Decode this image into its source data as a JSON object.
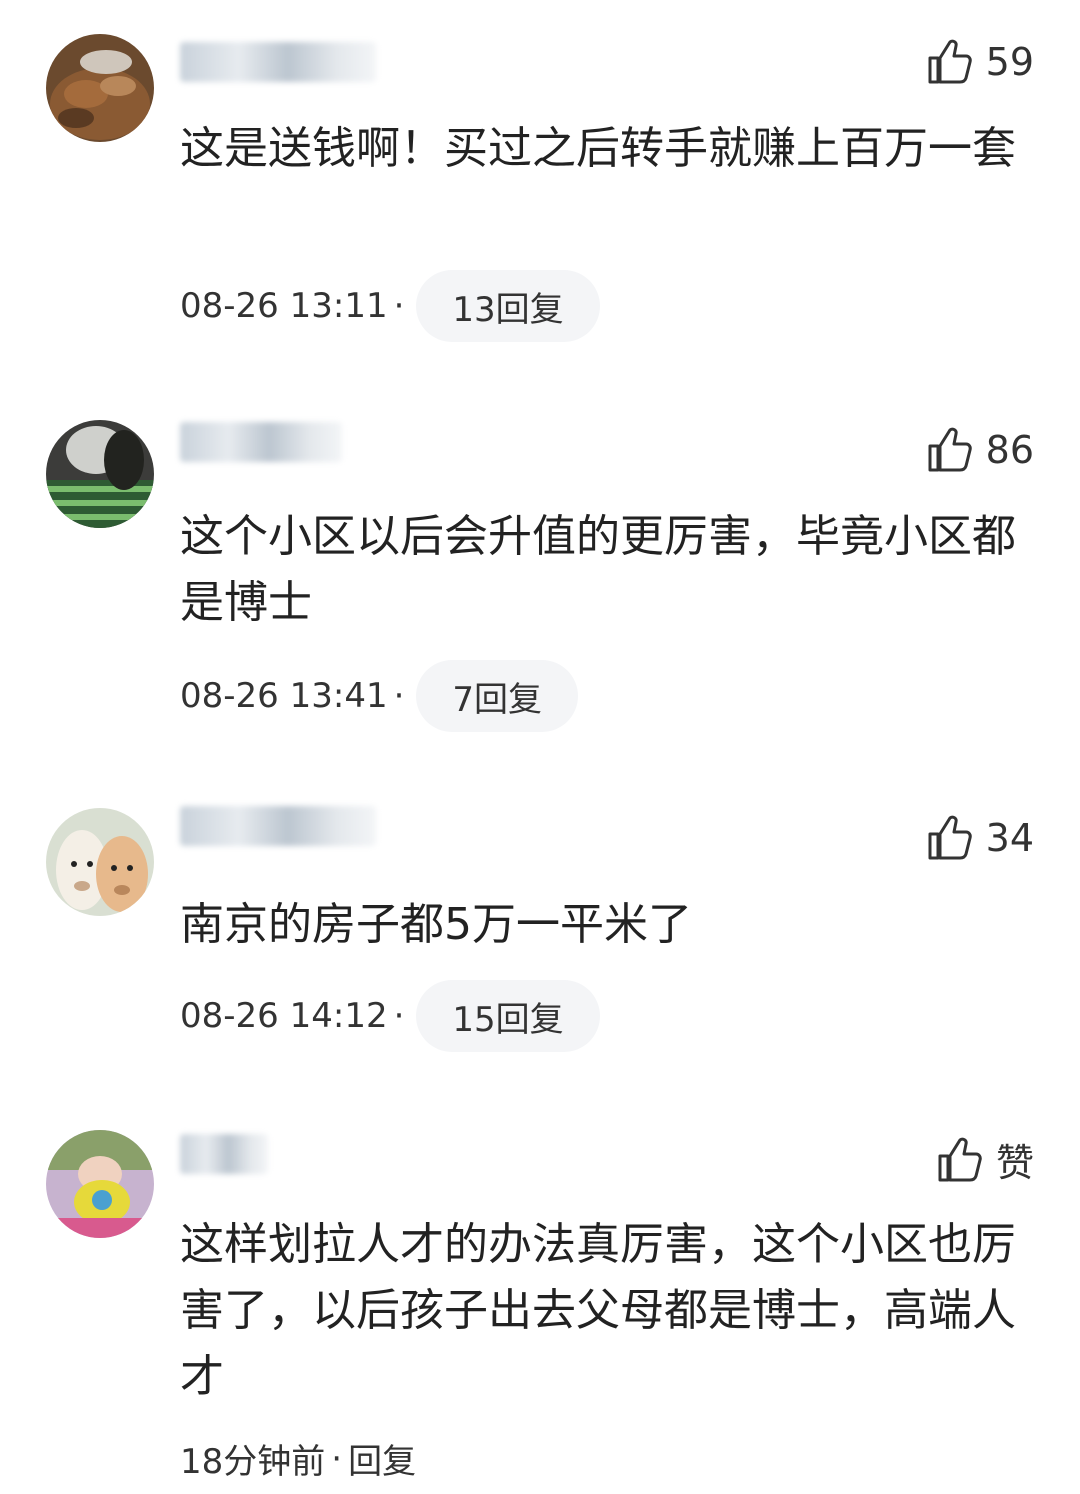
{
  "like_icon": "thumbs-up-icon",
  "comments": [
    {
      "like_count": "59",
      "text": "这是送钱啊！买过之后转手就赚上百万一套",
      "time": "08-26 13:11",
      "separator": "·",
      "reply_label": "13回复"
    },
    {
      "like_count": "86",
      "text": "这个小区以后会升值的更厉害，毕竟小区都是博士",
      "time": "08-26 13:41",
      "separator": "·",
      "reply_label": "7回复"
    },
    {
      "like_count": "34",
      "text": "南京的房子都5万一平米了",
      "time": "08-26 14:12",
      "separator": "·",
      "reply_label": "15回复"
    },
    {
      "like_count": "赞",
      "text": "这样划拉人才的办法真厉害，这个小区也厉害了，以后孩子出去父母都是博士，高端人才",
      "time": "18分钟前",
      "separator": "·",
      "reply_label": "回复"
    }
  ]
}
